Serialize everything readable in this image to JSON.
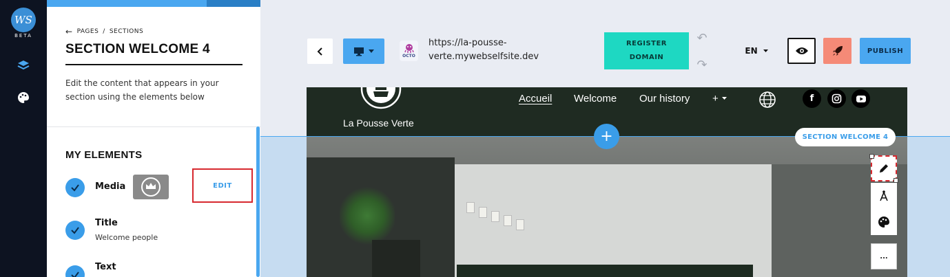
{
  "rail": {
    "logo_text": "WS",
    "beta_label": "BETA",
    "icons": [
      "layers-icon",
      "palette-icon"
    ]
  },
  "panel": {
    "breadcrumb": {
      "pages": "PAGES",
      "separator": "/",
      "sections": "SECTIONS"
    },
    "title": "SECTION WELCOME 4",
    "description": "Edit the content that appears in your section using the elements below",
    "elements_heading": "MY ELEMENTS",
    "elements": [
      {
        "name": "Media",
        "sub": "",
        "action": "EDIT"
      },
      {
        "name": "Title",
        "sub": "Welcome people"
      },
      {
        "name": "Text",
        "sub": ""
      }
    ]
  },
  "toolbar": {
    "url": "https://la-pousse-verte.mywebselfsite.dev",
    "site_icon_label": "OCTO",
    "register_line1": "REGISTER",
    "register_line2": "DOMAIN",
    "language": "EN",
    "publish": "PUBLISH"
  },
  "site": {
    "brand": "La Pousse Verte",
    "nav": [
      "Accueil",
      "Welcome",
      "Our history",
      "+"
    ],
    "active_nav": "Accueil",
    "social": [
      "f",
      "instagram-icon",
      "youtube-icon"
    ]
  },
  "overlay": {
    "section_badge": "SECTION WELCOME 4",
    "add_symbol": "+",
    "more_label": "..."
  },
  "colors": {
    "accent": "#4aa7f0",
    "register": "#1ed8c2",
    "rocket": "#f58a77",
    "site_dark": "#1f2b22",
    "highlight_red": "#d7282e"
  }
}
